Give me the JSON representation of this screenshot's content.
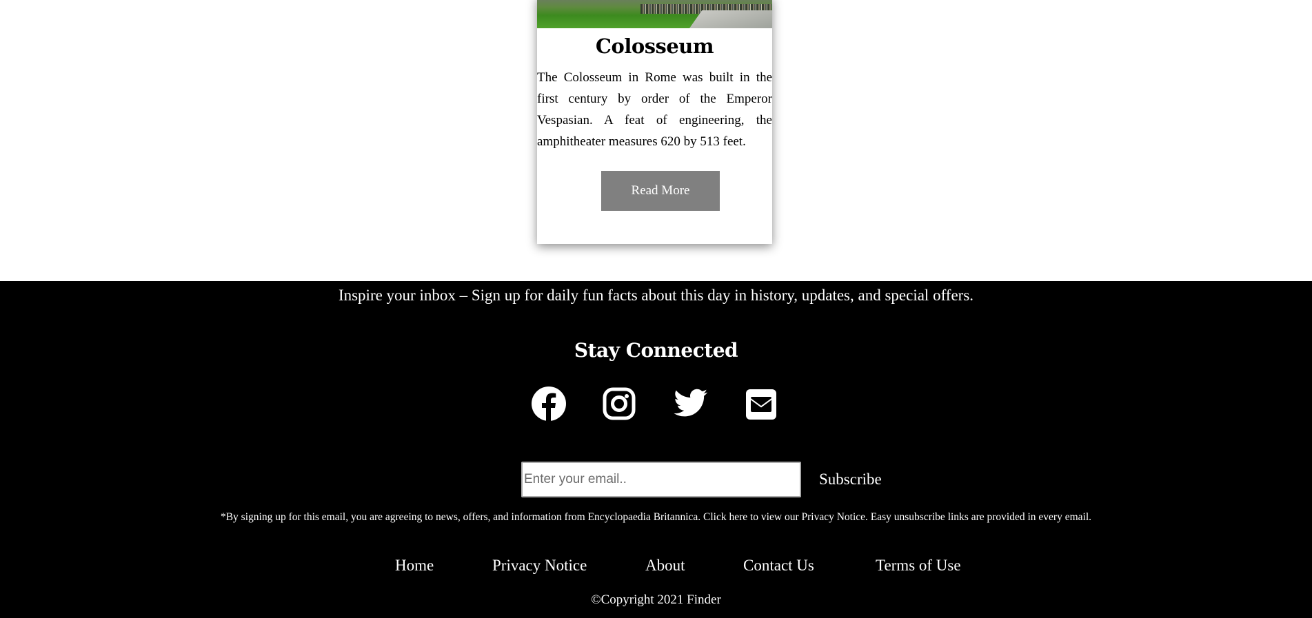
{
  "card": {
    "title": "Colosseum",
    "description": "The Colosseum in Rome was built in the first century by order of the Emperor Vespasian. A feat of engineering, the amphitheater measures 620 by 513 feet.",
    "button_label": "Read More",
    "image_icon": "colosseum-photo"
  },
  "footer": {
    "promo": "Inspire your inbox – Sign up for daily fun facts about this day in history, updates, and special offers.",
    "stay_connected": "Stay Connected",
    "socials": [
      {
        "name": "facebook",
        "icon": "facebook-icon"
      },
      {
        "name": "instagram",
        "icon": "instagram-icon"
      },
      {
        "name": "twitter",
        "icon": "twitter-icon"
      },
      {
        "name": "email",
        "icon": "envelope-icon"
      }
    ],
    "email_placeholder": "Enter your email..",
    "subscribe_label": "Subscribe",
    "disclaimer": "*By signing up for this email, you are agreeing to news, offers, and information from Encyclopaedia Britannica. Click here to view our Privacy Notice. Easy unsubscribe links are provided in every email.",
    "nav": [
      "Home",
      "Privacy Notice",
      "About",
      "Contact Us",
      "Terms of Use"
    ],
    "copyright": "©Copyright 2021 Finder"
  },
  "colors": {
    "footer_bg": "#000000",
    "button_bg": "#808080",
    "text_light": "#ffffff"
  }
}
